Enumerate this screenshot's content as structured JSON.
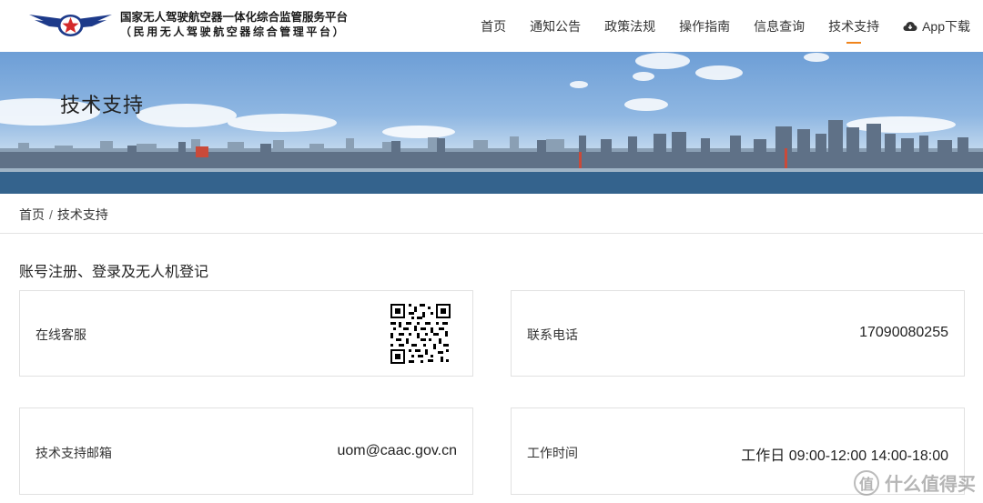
{
  "brand": {
    "title": "国家无人驾驶航空器一体化综合监管服务平台",
    "subtitle": "（民用无人驾驶航空器综合管理平台）"
  },
  "nav": {
    "items": [
      "首页",
      "通知公告",
      "政策法规",
      "操作指南",
      "信息查询",
      "技术支持"
    ],
    "active": "技术支持",
    "app_download": "App下载"
  },
  "banner": {
    "title": "技术支持"
  },
  "breadcrumb": {
    "home": "首页",
    "separator": "/",
    "current": "技术支持"
  },
  "section": {
    "title": "账号注册、登录及无人机登记"
  },
  "cards": {
    "online_service": {
      "label": "在线客服",
      "icon": "qr-code"
    },
    "phone": {
      "label": "联系电话",
      "value": "17090080255"
    },
    "email": {
      "label": "技术支持邮箱",
      "value": "uom@caac.gov.cn"
    },
    "hours": {
      "label": "工作时间",
      "value": "工作日 09:00-12:00 14:00-18:00"
    }
  },
  "watermark": {
    "text": "什么值得买",
    "icon": "值"
  },
  "colors": {
    "accent": "#f0841c",
    "logo_blue": "#1d3a8a",
    "logo_red": "#d42a2a"
  }
}
